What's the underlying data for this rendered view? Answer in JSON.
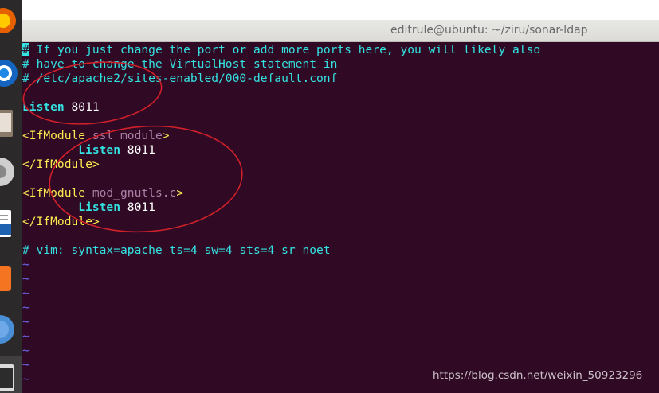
{
  "window": {
    "title": "editrule@ubuntu: ~/ziru/sonar-ldap"
  },
  "dock": {
    "items": [
      "firefox-icon",
      "chromium-icon",
      "files-icon",
      "rhythmbox-icon",
      "libreoffice-writer-icon",
      "ubuntu-software-icon",
      "help-icon",
      "terminal-icon"
    ]
  },
  "terminal": {
    "comment1_rest": " If you just change the port or add more ports here, you will likely also",
    "comment1_hash": "#",
    "comment2": "# have to change the VirtualHost statement in",
    "comment3": "# /etc/apache2/sites-enabled/000-default.conf",
    "listen_kw": "Listen",
    "listen_port": " 8011",
    "ifmodule_open": "<IfModule",
    "ssl_module": " ssl_module",
    "close_bracket": ">",
    "indent_listen_kw": "        Listen",
    "ssl_listen_port": " 8011",
    "ifmodule_close": "</IfModule>",
    "gnutls_module": " mod_gnutls.c",
    "gnutls_listen_port": " 8011",
    "modeline": "# vim: syntax=apache ts=4 sw=4 sts=4 sr noet",
    "tilde": "~"
  },
  "watermark": "https://blog.csdn.net/weixin_50923296",
  "colors": {
    "background": "#300a24",
    "comment": "#34e2e2",
    "tag": "#fce94f",
    "module": "#ad7fa8",
    "annotation": "#d0202a"
  }
}
